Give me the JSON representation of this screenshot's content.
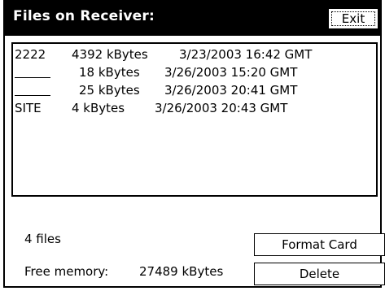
{
  "window": {
    "title": "Files on Receiver:",
    "exit_label": "Exit"
  },
  "files": [
    {
      "name": "2222",
      "size": "4392 kBytes",
      "date": "3/23/2003 16:42 GMT"
    },
    {
      "name": "",
      "size": "18 kBytes",
      "date": "3/26/2003 15:20 GMT"
    },
    {
      "name": "",
      "size": "25 kBytes",
      "date": "3/26/2003 20:41 GMT"
    },
    {
      "name": "SITE",
      "size": "4 kBytes",
      "date": "3/26/2003 20:43 GMT"
    }
  ],
  "status": {
    "file_count": "4 files",
    "free_memory_label": "Free memory:",
    "free_memory_value": "27489 kBytes"
  },
  "buttons": {
    "format_card": "Format Card",
    "delete": "Delete"
  }
}
